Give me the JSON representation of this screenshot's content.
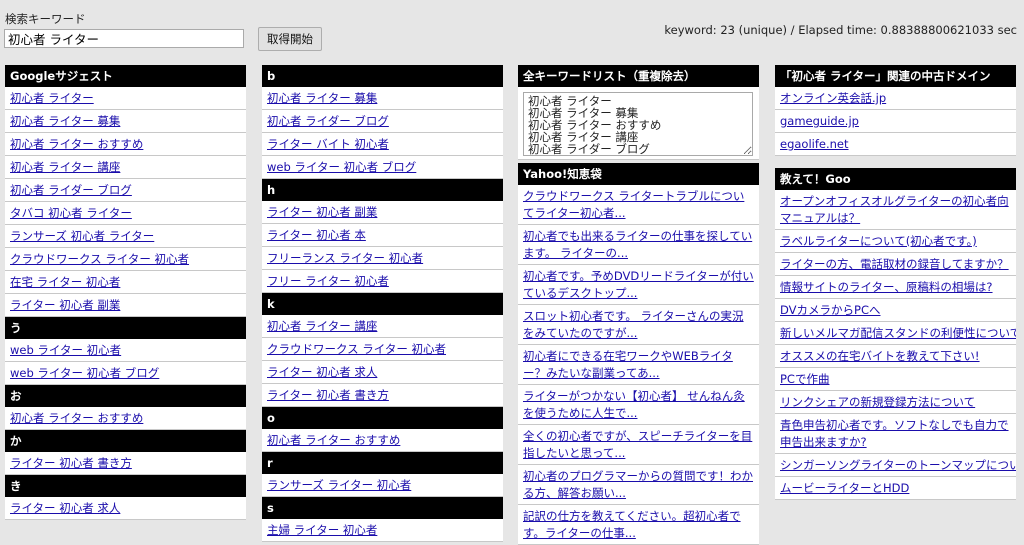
{
  "search": {
    "label": "検索キーワード",
    "value": "初心者 ライター",
    "button": "取得開始",
    "status": "keyword: 23 (unique) / Elapsed time: 0.88388800621033 sec"
  },
  "col1": {
    "header": "Googleサジェスト",
    "items": [
      "初心者 ライター",
      "初心者 ライター 募集",
      "初心者 ライター おすすめ",
      "初心者 ライター 講座",
      "初心者 ライダー ブログ",
      "タバコ 初心者 ライター",
      "ランサーズ 初心者 ライター",
      "クラウドワークス ライター 初心者",
      "在宅 ライター 初心者",
      "ライター 初心者 副業"
    ],
    "groups": [
      {
        "letter": "う",
        "items": [
          "web ライター 初心者",
          "web ライター 初心者 ブログ"
        ]
      },
      {
        "letter": "お",
        "items": [
          "初心者 ライター おすすめ"
        ]
      },
      {
        "letter": "か",
        "items": [
          "ライター 初心者 書き方"
        ]
      },
      {
        "letter": "き",
        "items": [
          "ライター 初心者 求人"
        ]
      }
    ]
  },
  "col2": {
    "groups": [
      {
        "letter": "b",
        "items": [
          "初心者 ライター 募集",
          "初心者 ライダー ブログ",
          "ライター バイト 初心者",
          "web ライター 初心者 ブログ"
        ]
      },
      {
        "letter": "h",
        "items": [
          "ライター 初心者 副業",
          "ライター 初心者 本",
          "フリーランス ライター 初心者",
          "フリー ライター 初心者"
        ]
      },
      {
        "letter": "k",
        "items": [
          "初心者 ライター 講座",
          "クラウドワークス ライター 初心者",
          "ライター 初心者 求人",
          "ライター 初心者 書き方"
        ]
      },
      {
        "letter": "o",
        "items": [
          "初心者 ライター おすすめ"
        ]
      },
      {
        "letter": "r",
        "items": [
          "ランサーズ ライター 初心者"
        ]
      },
      {
        "letter": "s",
        "items": [
          "主婦 ライター 初心者"
        ]
      }
    ]
  },
  "col3": {
    "list_header": "全キーワードリスト（重複除去）",
    "textarea": "初心者 ライター\n初心者 ライター 募集\n初心者 ライター おすすめ\n初心者 ライター 講座\n初心者 ライダー ブログ\nタバコ 初心者 ライター",
    "qa_header": "Yahoo!知恵袋",
    "qa_items": [
      "クラウドワークス ライタートラブルについてライター初心者...",
      "初心者でも出来るライターの仕事を探しています。 ライターの...",
      "初心者です。予めDVDリードライターが付いているデスクトップ...",
      "スロット初心者です。 ライターさんの実況をみていたのですが...",
      "初心者にできる在宅ワークやWEBライター？みたいな副業ってあ...",
      "ライターがつかない【初心者】 せんねん灸を使うために人生で...",
      "全くの初心者ですが、スピーチライターを目指したいと思って...",
      "初心者のプログラマーからの質問です！わかる方、解答お願い...",
      "記訳の仕方を教えてください。超初心者です。ライターの仕事..."
    ]
  },
  "col4": {
    "domain_header": "「初心者 ライター」関連の中古ドメイン",
    "domains": [
      "オンライン英会話.jp",
      "gameguide.jp",
      "egaolife.net"
    ],
    "goo_header": "教えて！Goo",
    "goo_items": [
      "オープンオフィスオルグライターの初心者向マニュアルは？",
      "ラベルライターについて(初心者です。)",
      "ライターの方、電話取材の録音してますか？",
      "情報サイトのライター、原稿料の相場は?",
      "DVカメラからPCへ",
      "新しいメルマガ配信スタンドの利便性について",
      "オススメの在宅バイトを教えて下さい!",
      "PCで作曲",
      "リンクシェアの新規登録方法について",
      "青色申告初心者です。ソフトなしでも自力で申告出来ますか?",
      "シンガーソングライターのトーンマップについて",
      "ムービーライターとHDD"
    ]
  }
}
